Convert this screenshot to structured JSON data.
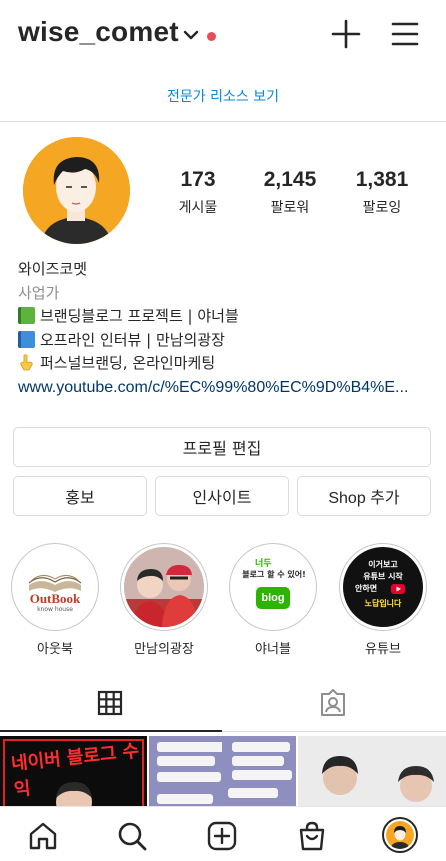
{
  "header": {
    "username": "wise_comet",
    "notification_color": "#ed4956",
    "icons": [
      "chevron-down-icon",
      "plus-icon",
      "hamburger-menu-icon"
    ]
  },
  "pro_resources_link": "전문가 리소스 보기",
  "stats": [
    {
      "count": "173",
      "label": "게시물"
    },
    {
      "count": "2,145",
      "label": "팔로워"
    },
    {
      "count": "1,381",
      "label": "팔로잉"
    }
  ],
  "bio": {
    "name": "와이즈코멧",
    "category": "사업가",
    "lines": [
      {
        "icon": "green-book-icon",
        "text": "브랜딩블로그 프로젝트 | 야너블"
      },
      {
        "icon": "blue-book-icon",
        "text": "오프라인 인터뷰 | 만남의광장"
      },
      {
        "icon": "pointing-down-hand-icon",
        "text": "퍼스널브랜딩, 온라인마케팅"
      }
    ],
    "link": "www.youtube.com/c/%EC%99%80%EC%9D%B4%E..."
  },
  "buttons": {
    "edit_profile": "프로필 편집",
    "promotions": "홍보",
    "insights": "인사이트",
    "shop_add": "Shop 추가"
  },
  "highlights": [
    {
      "label": "아웃북",
      "logo_main": "OutBook",
      "logo_sub": "know house"
    },
    {
      "label": "만남의광장"
    },
    {
      "label": "야너블",
      "cover_text_1": "너두",
      "cover_text_2": "블로그 할 수 있어!",
      "cover_badge": "blog"
    },
    {
      "label": "유튜브",
      "cover_text_1": "이거보고",
      "cover_text_2": "유튜브 시작",
      "cover_text_3": "안하면",
      "cover_text_4": "노답입니다"
    }
  ],
  "tabs": [
    {
      "name": "grid-icon",
      "active": true
    },
    {
      "name": "tagged-icon",
      "active": false
    }
  ],
  "posts": [
    {
      "text": "네이버 블로그 수익"
    },
    {
      "text": ""
    },
    {
      "text": ""
    },
    {
      "text": ""
    }
  ],
  "bottom_nav": [
    "home-icon",
    "search-icon",
    "new-post-icon",
    "shop-icon",
    "profile-avatar"
  ],
  "colors": {
    "link": "#0a8ad6",
    "avatar_bg": "#f5a623",
    "blog_green": "#2db400",
    "youtube_red": "#e6002d"
  }
}
